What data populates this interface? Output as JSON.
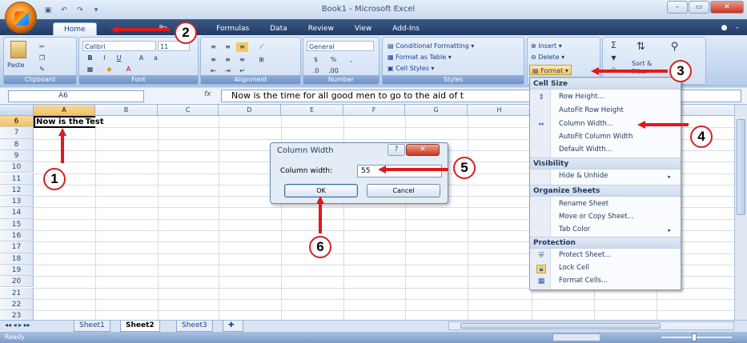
{
  "window": {
    "title": "Book1 - Microsoft Excel",
    "minimize": "–",
    "restore": "▭",
    "close": "✕"
  },
  "qat": {
    "save": "▣",
    "undo": "↶",
    "redo": "↷",
    "customize": "▾"
  },
  "tabs": [
    "Home",
    "Insert",
    "Page Layout",
    "Formulas",
    "Data",
    "Review",
    "View",
    "Add-Ins"
  ],
  "tab_labels_visible": {
    "home": "Home",
    "page": "Pa",
    "formulas": "Formulas",
    "data": "Data",
    "review": "Review",
    "view": "View",
    "addins": "Add-Ins"
  },
  "ribbon": {
    "clipboard": {
      "label": "Clipboard",
      "paste": "Paste"
    },
    "font": {
      "label": "Font",
      "name": "Calibri",
      "size": "11"
    },
    "alignment": {
      "label": "Alignment"
    },
    "number": {
      "label": "Number",
      "format": "General",
      "currency": "$",
      "percent": "%"
    },
    "styles": {
      "label": "Styles",
      "conditional": "Conditional Formatting",
      "format_table": "Format as Table",
      "cell_styles": "Cell Styles"
    },
    "cells": {
      "insert": "Insert",
      "delete": "Delete",
      "format": "Format"
    },
    "editing": {
      "sigma": "Σ",
      "sort": "Sort &",
      "filter": "Filter"
    }
  },
  "formula_bar": {
    "name_box": "A6",
    "fx": "fx",
    "content": "Now is the time for all good men to go to the aid of t"
  },
  "columns": [
    "A",
    "B",
    "C",
    "D",
    "E",
    "F",
    "G",
    "H"
  ],
  "rows": [
    "6",
    "7",
    "8",
    "9",
    "10",
    "11",
    "12",
    "13",
    "14",
    "15",
    "16",
    "17",
    "18",
    "19",
    "20",
    "21",
    "22",
    "23"
  ],
  "cells": {
    "a6": "Now is the",
    "a6_rest": "Test"
  },
  "sheets": [
    "Sheet1",
    "Sheet2",
    "Sheet3"
  ],
  "status": "Ready",
  "menu": {
    "cell_size": "Cell Size",
    "row_height": "Row Height...",
    "autofit_row": "AutoFit Row Height",
    "column_width": "Column Width...",
    "autofit_col": "AutoFit Column Width",
    "default_width": "Default Width...",
    "visibility": "Visibility",
    "hide_unhide": "Hide & Unhide",
    "organize": "Organize Sheets",
    "rename": "Rename Sheet",
    "move_copy": "Move or Copy Sheet...",
    "tab_color": "Tab Color",
    "protection": "Protection",
    "protect_sheet": "Protect Sheet...",
    "lock_cell": "Lock Cell",
    "format_cells": "Format Cells..."
  },
  "dialog": {
    "title": "Column Width",
    "help": "?",
    "close": "✕",
    "label": "Column width:",
    "value": "55",
    "ok": "OK",
    "cancel": "Cancel"
  },
  "annotations": {
    "n1": "1",
    "n2": "2",
    "n3": "3",
    "n4": "4",
    "n5": "5",
    "n6": "6"
  },
  "colors": {
    "accent": "#1f3a63",
    "annotation": "#e01a1a"
  }
}
